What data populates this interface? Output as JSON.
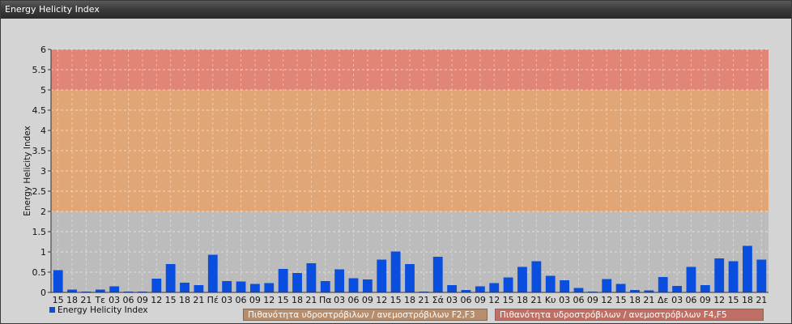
{
  "window": {
    "title": "Energy Helicity Index"
  },
  "chart_data": {
    "type": "bar",
    "ylabel": "Energy Helicity Index",
    "ylim": [
      0,
      6
    ],
    "yticks": [
      "0",
      "0.5",
      "1",
      "1.5",
      "2",
      "2.5",
      "3",
      "3.5",
      "4",
      "4.5",
      "5",
      "5.5",
      "6"
    ],
    "grid": true,
    "categories": [
      "15",
      "18",
      "21",
      "Τε",
      "03",
      "06",
      "09",
      "12",
      "15",
      "18",
      "21",
      "Πέ",
      "03",
      "06",
      "09",
      "12",
      "15",
      "18",
      "21",
      "Πα",
      "03",
      "06",
      "09",
      "12",
      "15",
      "18",
      "21",
      "Σά",
      "03",
      "06",
      "09",
      "12",
      "15",
      "18",
      "21",
      "Κυ",
      "03",
      "06",
      "09",
      "12",
      "15",
      "18",
      "21",
      "Δε",
      "03",
      "06",
      "09",
      "12",
      "15",
      "18",
      "21"
    ],
    "series": [
      {
        "name": "Energy Helicity Index",
        "color": "#0a4ee0",
        "values": [
          0.55,
          0.07,
          0.02,
          0.07,
          0.15,
          0.02,
          0.02,
          0.34,
          0.7,
          0.24,
          0.18,
          0.93,
          0.28,
          0.27,
          0.21,
          0.23,
          0.58,
          0.48,
          0.72,
          0.28,
          0.57,
          0.35,
          0.32,
          0.81,
          1.01,
          0.7,
          0.02,
          0.88,
          0.18,
          0.06,
          0.15,
          0.23,
          0.37,
          0.63,
          0.77,
          0.41,
          0.3,
          0.11,
          0.02,
          0.33,
          0.21,
          0.06,
          0.05,
          0.38,
          0.16,
          0.63,
          0.18,
          0.84,
          0.77,
          1.15,
          0.81
        ]
      }
    ],
    "bands": [
      {
        "from": 2,
        "to": 5,
        "color": "#e8a26a",
        "label": "Πιθανότητα υδροστρόβιλων / ανεμοστρόβιλων F2,F3"
      },
      {
        "from": 5,
        "to": 6,
        "color": "#e87c6a",
        "label": "Πιθανότητα υδροστρόβιλων / ανεμοστρόβιλων F4,F5"
      }
    ],
    "legend_position": "bottom"
  }
}
